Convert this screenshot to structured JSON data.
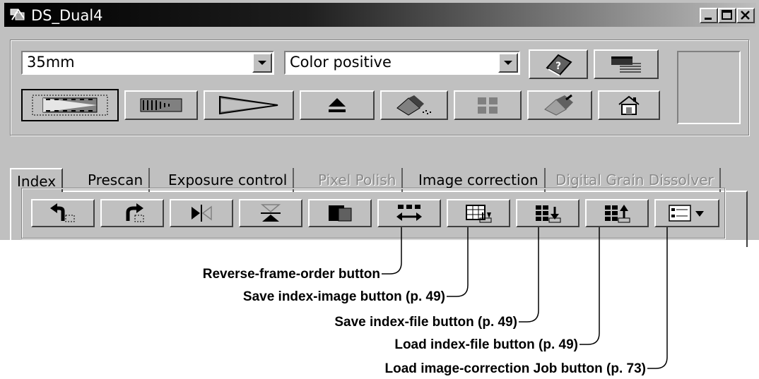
{
  "window": {
    "title": "DS_Dual4"
  },
  "controls": {
    "film_format": "35mm",
    "film_type": "Color positive"
  },
  "tabs": [
    {
      "label": "Index",
      "active": true,
      "enabled": true
    },
    {
      "label": "Prescan",
      "active": false,
      "enabled": true
    },
    {
      "label": "Exposure control",
      "active": false,
      "enabled": true
    },
    {
      "label": "Pixel Polish",
      "active": false,
      "enabled": false
    },
    {
      "label": "Image correction",
      "active": false,
      "enabled": true
    },
    {
      "label": "Digital Grain Dissolver",
      "active": false,
      "enabled": false
    }
  ],
  "index_toolbar": [
    "rotate-left-icon",
    "rotate-right-icon",
    "flip-horizontal-icon",
    "flip-vertical-icon",
    "invert-selection-icon",
    "reverse-frame-order-icon",
    "save-index-image-icon",
    "save-index-file-icon",
    "load-index-file-icon",
    "load-job-icon"
  ],
  "callouts": {
    "reverse_frame_order": "Reverse-frame-order button",
    "save_index_image": "Save index-image button (p. 49)",
    "save_index_file": "Save index-file button (p. 49)",
    "load_index_file": "Load index-file button (p. 49)",
    "load_job": "Load image-correction Job button (p. 73)"
  }
}
